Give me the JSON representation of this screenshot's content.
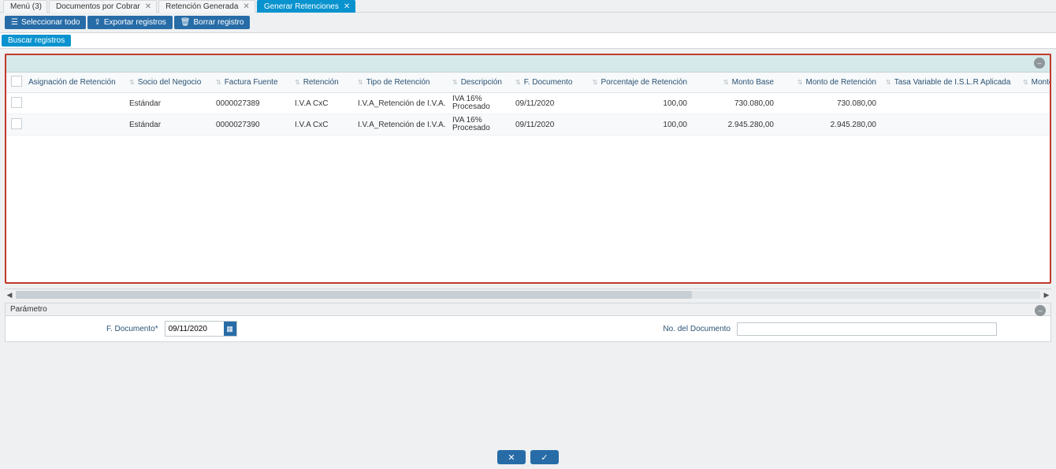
{
  "tabs": [
    {
      "label": "Menú (3)",
      "closable": false,
      "active": false
    },
    {
      "label": "Documentos por Cobrar",
      "closable": true,
      "active": false
    },
    {
      "label": "Retención Generada",
      "closable": true,
      "active": false
    },
    {
      "label": "Generar Retenciones",
      "closable": true,
      "active": true
    }
  ],
  "toolbar": {
    "select_all": "Seleccionar todo",
    "export": "Exportar registros",
    "delete": "Borrar registro"
  },
  "search_tab": "Buscar registros",
  "columns": [
    "Asignación de Retención",
    "Socio del Negocio",
    "Factura Fuente",
    "Retención",
    "Tipo de Retención",
    "Descripción",
    "F. Documento",
    "Porcentaje de Retención",
    "Monto Base",
    "Monto de Retención",
    "Tasa Variable de I.S.L.R Aplicada",
    "Monto Base C"
  ],
  "rows": [
    {
      "asignacion": "",
      "socio": "Estándar",
      "factura": "0000027389",
      "retencion": "I.V.A CxC",
      "tipo": "I.V.A_Retención de I.V.A.",
      "descripcion": "IVA 16% Procesado",
      "fdoc": "09/11/2020",
      "porcentaje": "100,00",
      "monto_base": "730.080,00",
      "monto_ret": "730.080,00",
      "tasa": "",
      "monto_base_c": ""
    },
    {
      "asignacion": "",
      "socio": "Estándar",
      "factura": "0000027390",
      "retencion": "I.V.A CxC",
      "tipo": "I.V.A_Retención de I.V.A.",
      "descripcion": "IVA 16% Procesado",
      "fdoc": "09/11/2020",
      "porcentaje": "100,00",
      "monto_base": "2.945.280,00",
      "monto_ret": "2.945.280,00",
      "tasa": "",
      "monto_base_c": ""
    }
  ],
  "param": {
    "title": "Parámetro",
    "fdoc_label": "F. Documento*",
    "fdoc_value": "09/11/2020",
    "docno_label": "No. del Documento",
    "docno_value": ""
  }
}
